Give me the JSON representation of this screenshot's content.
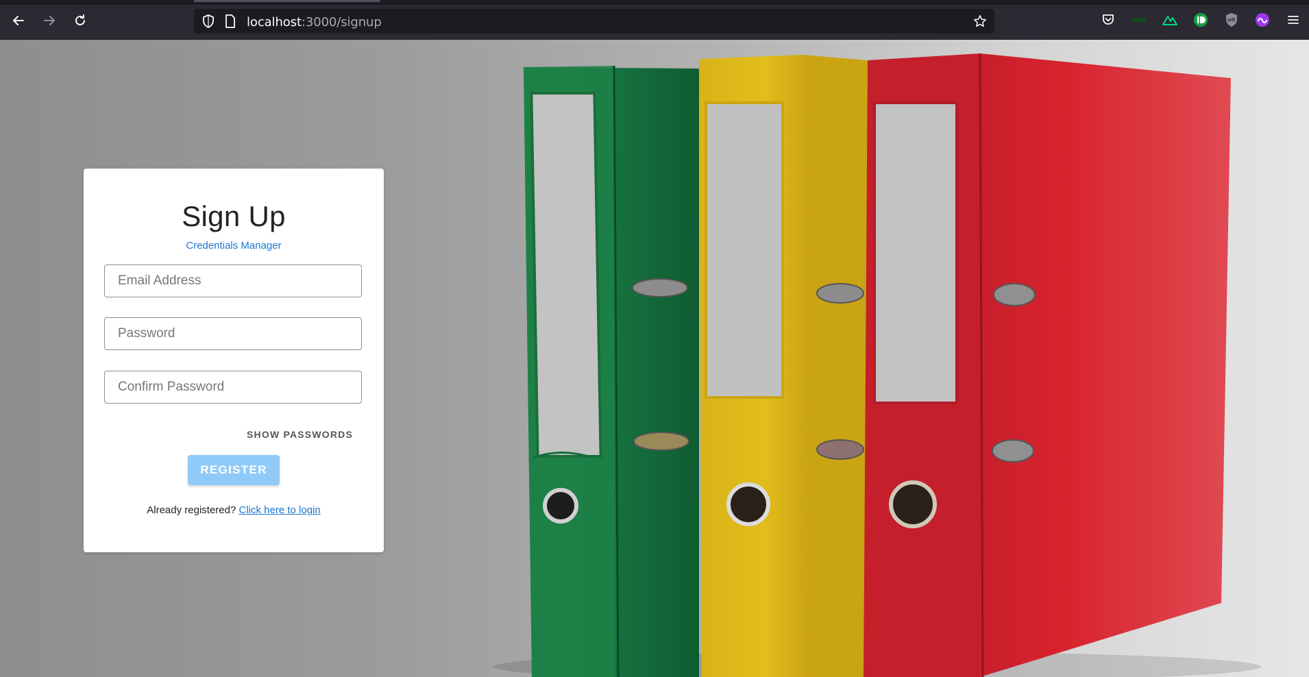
{
  "browser": {
    "url_host": "localhost",
    "url_rest": ":3000/signup"
  },
  "form": {
    "title": "Sign Up",
    "subtitle": "Credentials Manager",
    "email_placeholder": "Email Address",
    "password_placeholder": "Password",
    "confirm_placeholder": "Confirm Password",
    "show_passwords_label": "SHOW PASSWORDS",
    "register_label": "REGISTER",
    "login_prompt": "Already registered?",
    "login_link": "Click here to login"
  },
  "colors": {
    "accent": "#1976d2",
    "register_button": "#90caf9",
    "binder_green": "#1e7a44",
    "binder_yellow": "#d9b417",
    "binder_red": "#d3232f"
  }
}
